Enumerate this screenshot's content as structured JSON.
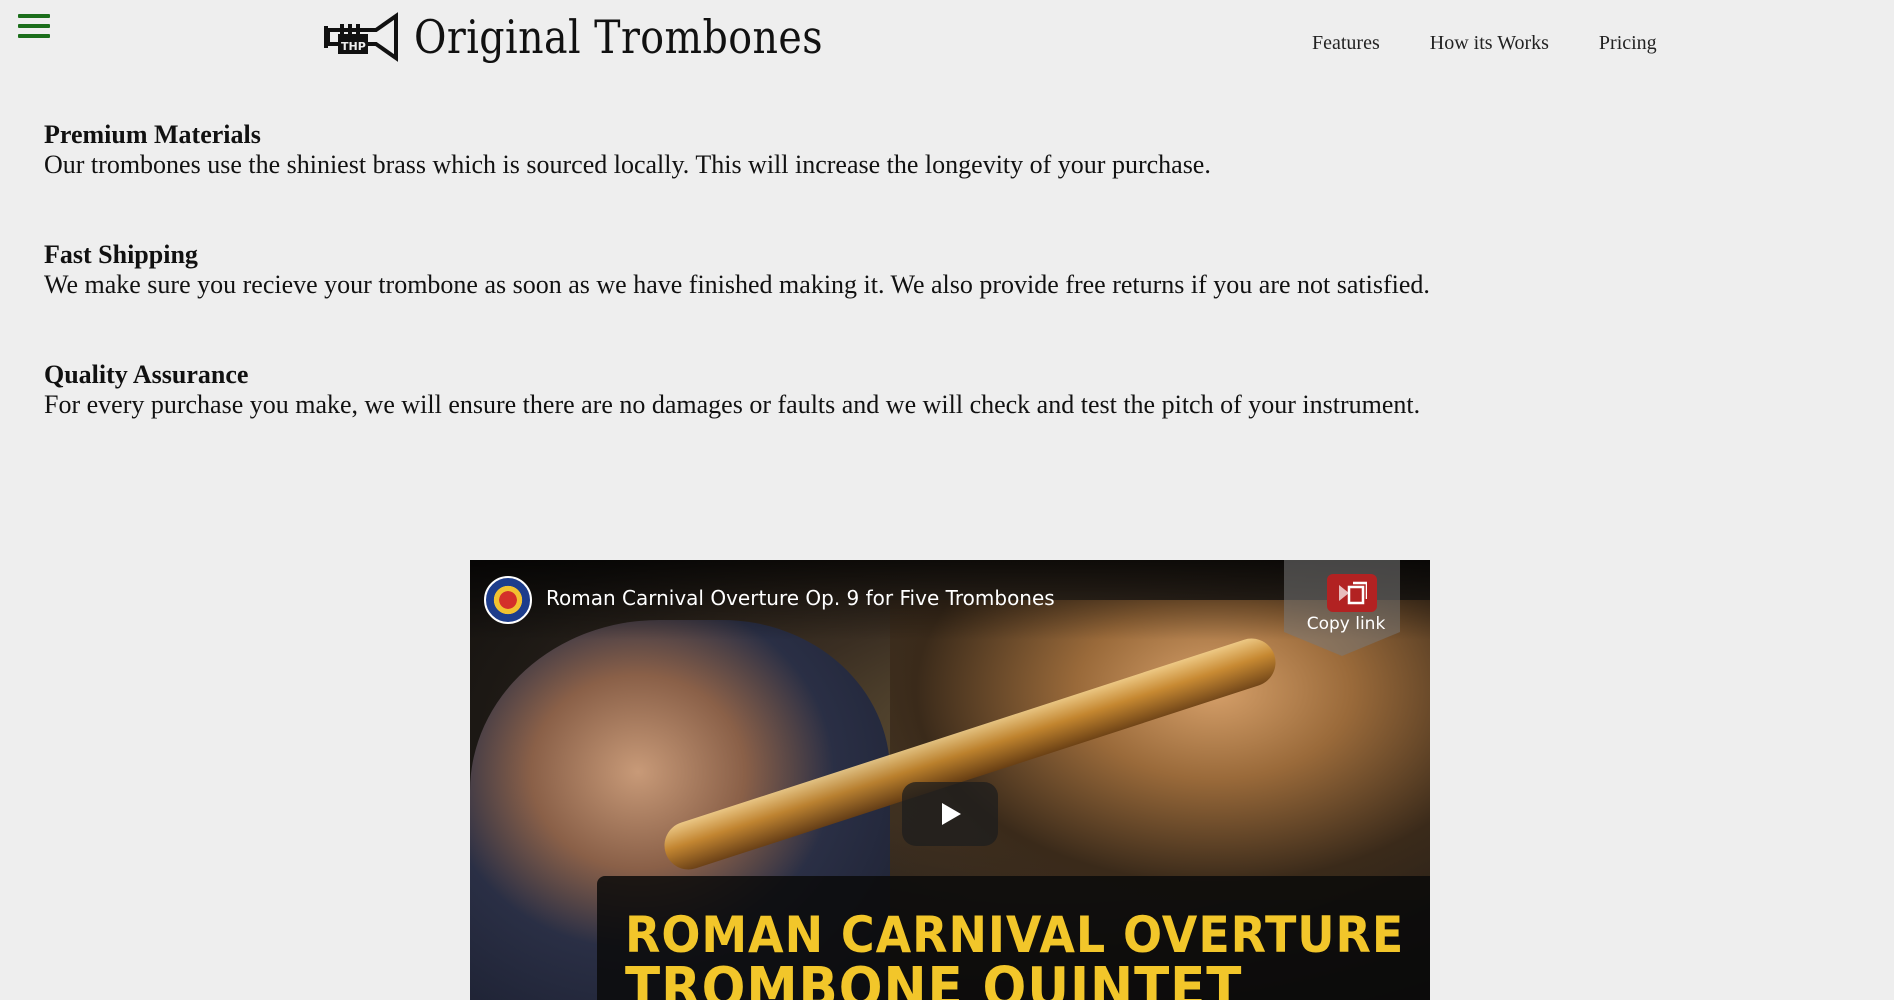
{
  "header": {
    "brand_name": "Original Trombones",
    "logo_icon": "trumpet-logo-icon",
    "menu_icon": "hamburger-menu-icon",
    "nav": [
      {
        "label": "Features"
      },
      {
        "label": "How its Works"
      },
      {
        "label": "Pricing"
      }
    ]
  },
  "features": [
    {
      "title": "Premium Materials",
      "description": "Our trombones use the shiniest brass which is sourced locally. This will increase the longevity of your purchase."
    },
    {
      "title": "Fast Shipping",
      "description": "We make sure you recieve your trombone as soon as we have finished making it. We also provide free returns if you are not satisfied."
    },
    {
      "title": "Quality Assurance",
      "description": "For every purchase you make, we will ensure there are no damages or faults and we will check and test the pitch of your instrument."
    }
  ],
  "video": {
    "title": "Roman Carnival Overture Op. 9 for Five Trombones",
    "copy_link_label": "Copy link",
    "caption_line1": "ROMAN CARNIVAL OVERTURE",
    "caption_line2": "TROMBONE QUINTET"
  },
  "colors": {
    "background": "#eeeeee",
    "menu_icon": "#1b6e1b",
    "caption_text": "#f2c62a"
  }
}
